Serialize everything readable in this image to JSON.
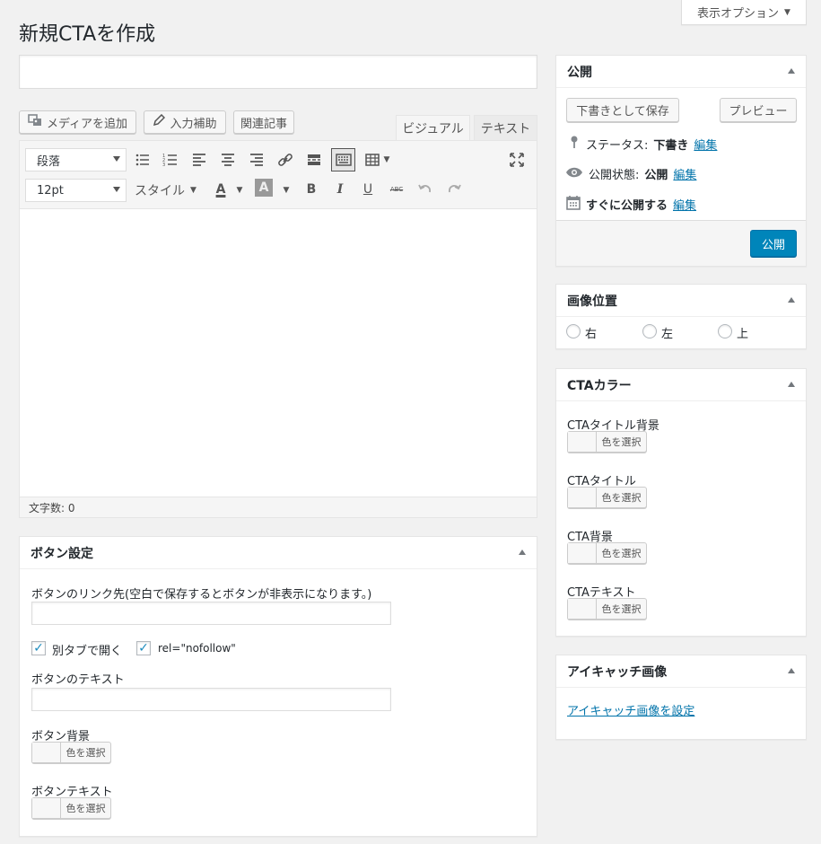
{
  "header": {
    "screen_options": "表示オプション",
    "page_title": "新規CTAを作成",
    "title_input_value": ""
  },
  "editor": {
    "add_media": "メディアを追加",
    "input_assist": "入力補助",
    "related_posts": "関連記事",
    "tab_visual": "ビジュアル",
    "tab_text": "テキスト",
    "format_select": "段落",
    "font_size_select": "12pt",
    "style_menu": "スタイル",
    "word_count": "文字数: 0"
  },
  "button_settings": {
    "title": "ボタン設定",
    "link_label": "ボタンのリンク先(空白で保存するとボタンが非表示になります。)",
    "link_value": "",
    "new_tab_label": "別タブで開く",
    "new_tab_checked": true,
    "nofollow_label": "rel=\"nofollow\"",
    "nofollow_checked": true,
    "button_text_label": "ボタンのテキスト",
    "button_text_value": "",
    "button_bg_label": "ボタン背景",
    "button_text_color_label": "ボタンテキスト",
    "choose_color": "色を選択"
  },
  "publish": {
    "title": "公開",
    "save_draft": "下書きとして保存",
    "preview": "プレビュー",
    "status_label": "ステータス:",
    "status_value": "下書き",
    "visibility_label": "公開状態:",
    "visibility_value": "公開",
    "schedule_label": "すぐに公開する",
    "edit": "編集",
    "publish_button": "公開",
    "accent_color": "#0085ba"
  },
  "image_position": {
    "title": "画像位置",
    "options": [
      "右",
      "左",
      "上"
    ]
  },
  "cta_colors": {
    "title": "CTAカラー",
    "fields": [
      "CTAタイトル背景",
      "CTAタイトル",
      "CTA背景",
      "CTAテキスト"
    ],
    "choose_color": "色を選択"
  },
  "featured_image": {
    "title": "アイキャッチ画像",
    "set_link": "アイキャッチ画像を設定"
  }
}
